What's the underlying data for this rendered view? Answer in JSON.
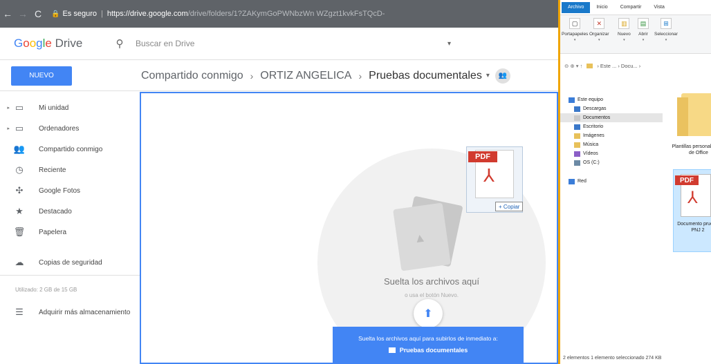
{
  "browser": {
    "back_glyph": "←",
    "forward_glyph": "→",
    "reload_glyph": "C",
    "lock_glyph": "🔒",
    "secure_label": "Es seguro",
    "url_host": "https://drive.google.com",
    "url_path": "/drive/folders/1?ZAKymGoPWNbzWn WZgzt1kvkFsTQcD-"
  },
  "drive": {
    "logo_google_parts": [
      "G",
      "o",
      "o",
      "g",
      "l",
      "e"
    ],
    "logo_product": " Drive",
    "search_icon": "⚲",
    "search_placeholder": "Buscar en Drive",
    "search_caret": "▾",
    "new_button": "NUEVO",
    "breadcrumb": {
      "item1": "Compartido conmigo",
      "chev": "›",
      "item2": "ORTIZ ANGELICA",
      "current": "Pruebas documentales",
      "dd": "▾",
      "share_icon": "👥"
    },
    "sidebar": {
      "items": [
        {
          "arrow": "▸",
          "icon": "▭",
          "label": "Mi unidad"
        },
        {
          "arrow": "▸",
          "icon": "▭",
          "label": "Ordenadores"
        },
        {
          "arrow": "",
          "icon": "👥",
          "label": "Compartido conmigo"
        },
        {
          "arrow": "",
          "icon": "◷",
          "label": "Reciente"
        },
        {
          "arrow": "",
          "icon": "✣",
          "label": "Google Fotos"
        },
        {
          "arrow": "",
          "icon": "★",
          "label": "Destacado"
        },
        {
          "arrow": "",
          "icon": "🗑",
          "label": "Papelera"
        },
        {
          "arrow": "",
          "icon": "☁",
          "label": "Copias de seguridad"
        }
      ],
      "storage_text": "Utilizado: 2 GB de 15 GB",
      "buy_icon": "☰",
      "buy_label": "Adquirir más almacenamiento"
    },
    "dropzone": {
      "title": "Suelta los archivos aquí",
      "subtitle": "o usa el botón Nuevo.",
      "upload_glyph": "⬆",
      "drag_badge": "PDF",
      "drag_acro": "⅄",
      "copy_tip": "+ Copiar",
      "banner_line1": "Suelta los archivos aquí para subirlos de inmediato a:",
      "banner_folder": "Pruebas documentales"
    }
  },
  "explorer": {
    "tabs": [
      "Archivo",
      "Inicio",
      "Compartir",
      "Vista"
    ],
    "ribbon": [
      {
        "icon": "▢",
        "label": "Portapapeles",
        "dd": "▾"
      },
      {
        "icon": "✕",
        "label": "Organizar",
        "dd": "▾"
      },
      {
        "icon": "▥",
        "label": "Nuevo",
        "dd": "▾"
      },
      {
        "icon": "▤",
        "label": "Abrir",
        "dd": "▾"
      },
      {
        "icon": "⊞",
        "label": "Seleccionar",
        "dd": "▾"
      }
    ],
    "address": {
      "nav": "⊖ ⊕ ▾ ↑",
      "crumb": "› Este ... › Docu... ›"
    },
    "tree": [
      {
        "label": "Este equipo",
        "color": "#3b7dd8"
      },
      {
        "label": "Descargas",
        "color": "#3a78c9"
      },
      {
        "label": "Documentos",
        "color": "#c9c9c9",
        "selected": true
      },
      {
        "label": "Escritorio",
        "color": "#3a78c9"
      },
      {
        "label": "Imágenes",
        "color": "#e8c15a"
      },
      {
        "label": "Música",
        "color": "#e8c15a"
      },
      {
        "label": "Vídeos",
        "color": "#8b5fc7"
      },
      {
        "label": "OS (C:)",
        "color": "#6c8aa5"
      },
      {
        "label": "Red",
        "color": "#3b7dd8"
      }
    ],
    "folder_label": "Plantillas personalizadas de Office",
    "file_badge": "PDF",
    "file_acro": "⅄",
    "file_label": "Documento prueba PNJ 2",
    "status": "2 elementos    1 elemento seleccionado  274 KB"
  }
}
